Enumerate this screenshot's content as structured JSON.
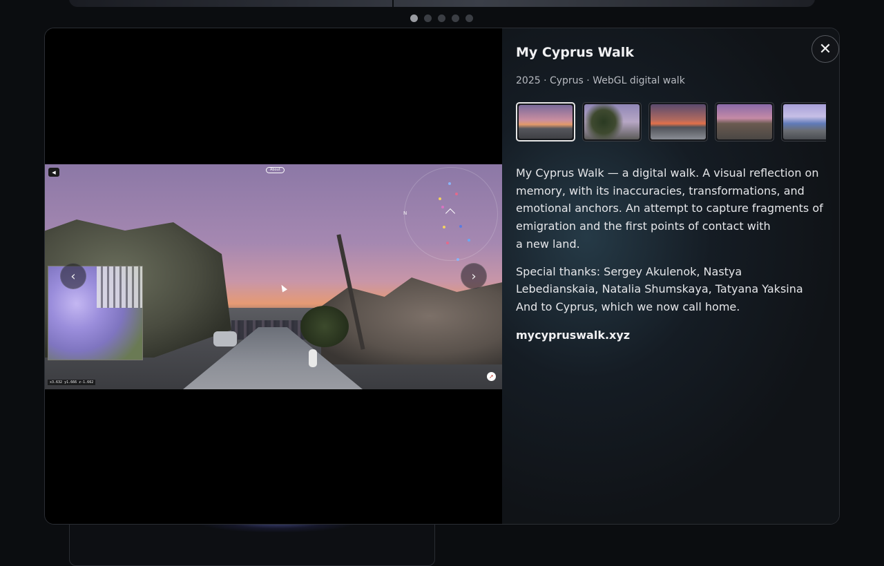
{
  "carousel": {
    "total_slides": 5,
    "active_slide": 1
  },
  "project": {
    "title": "My Cyprus Walk",
    "meta": "2025 · Cyprus · WebGL digital walk",
    "description_lines": [
      "My Cyprus Walk — a digital walk. A visual reflection on",
      "memory, with its inaccuracies, transformations, and",
      "emotional anchors. An attempt to capture fragments of",
      "emigration and the first points of contact with",
      "a new land."
    ],
    "thanks_lines": [
      "Special thanks: Sergey Akulenok, Nastya",
      "Lebedianskaia, Natalia Shumskaya, Tatyana Yaksina",
      "And to Cyprus, which we now call home."
    ],
    "link": "mycypruswalk.xyz"
  },
  "gallery": {
    "thumbnails": [
      {
        "name": "thumbnail-1",
        "active": true
      },
      {
        "name": "thumbnail-2",
        "active": false
      },
      {
        "name": "thumbnail-3",
        "active": false
      },
      {
        "name": "thumbnail-4",
        "active": false
      },
      {
        "name": "thumbnail-5",
        "active": false
      }
    ],
    "prev_icon": "chevron-left-icon",
    "next_icon": "chevron-right-icon"
  },
  "scene_overlay": {
    "about_label": "About",
    "compass_label": "N",
    "coords_text": "x3.632 y1.666 z-1.662"
  },
  "icons": {
    "close": "close-icon"
  },
  "colors": {
    "background": "#0b0d10",
    "panel": "#101317",
    "text": "#e6e7ea"
  }
}
